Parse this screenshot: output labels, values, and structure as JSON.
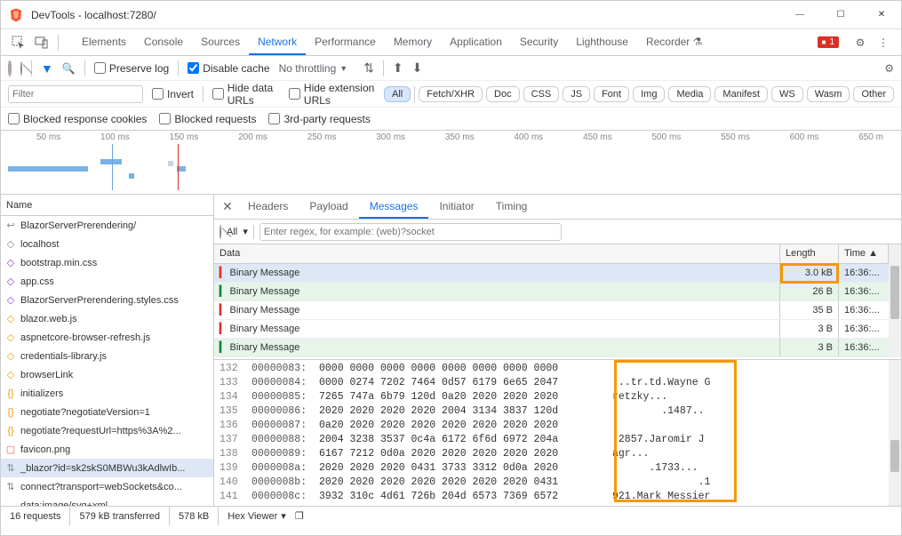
{
  "window": {
    "title": "DevTools - localhost:7280/"
  },
  "toolbar_tabs": [
    "Elements",
    "Console",
    "Sources",
    "Network",
    "Performance",
    "Memory",
    "Application",
    "Security",
    "Lighthouse",
    "Recorder ⚗"
  ],
  "toolbar_active": "Network",
  "error_count": "1",
  "network_toolbar": {
    "preserve_log": "Preserve log",
    "disable_cache": "Disable cache",
    "throttling": "No throttling"
  },
  "filter": {
    "placeholder": "Filter",
    "invert": "Invert",
    "hide_data": "Hide data URLs",
    "hide_ext": "Hide extension URLs",
    "pills": [
      "All",
      "Fetch/XHR",
      "Doc",
      "CSS",
      "JS",
      "Font",
      "Img",
      "Media",
      "Manifest",
      "WS",
      "Wasm",
      "Other"
    ],
    "active_pill": "All",
    "blocked_cookies": "Blocked response cookies",
    "blocked_req": "Blocked requests",
    "third_party": "3rd-party requests"
  },
  "timeline_ticks": [
    "50 ms",
    "100 ms",
    "150 ms",
    "200 ms",
    "250 ms",
    "300 ms",
    "350 ms",
    "400 ms",
    "450 ms",
    "500 ms",
    "550 ms",
    "600 ms",
    "650 m"
  ],
  "name_header": "Name",
  "requests": [
    {
      "icon": "↩",
      "cls": "gray",
      "label": "BlazorServerPrerendering/"
    },
    {
      "icon": "◇",
      "cls": "gray",
      "label": "localhost"
    },
    {
      "icon": "◇",
      "cls": "purple",
      "label": "bootstrap.min.css"
    },
    {
      "icon": "◇",
      "cls": "purple",
      "label": "app.css"
    },
    {
      "icon": "◇",
      "cls": "purple",
      "label": "BlazorServerPrerendering.styles.css"
    },
    {
      "icon": "◇",
      "cls": "orange",
      "label": "blazor.web.js"
    },
    {
      "icon": "◇",
      "cls": "orange",
      "label": "aspnetcore-browser-refresh.js"
    },
    {
      "icon": "◇",
      "cls": "orange",
      "label": "credentials-library.js"
    },
    {
      "icon": "◇",
      "cls": "orange",
      "label": "browserLink"
    },
    {
      "icon": "{}",
      "cls": "orange",
      "label": "initializers"
    },
    {
      "icon": "{}",
      "cls": "orange",
      "label": "negotiate?negotiateVersion=1"
    },
    {
      "icon": "{}",
      "cls": "orange",
      "label": "negotiate?requestUrl=https%3A%2..."
    },
    {
      "icon": "▢",
      "cls": "pink",
      "label": "favicon.png"
    },
    {
      "icon": "⇅",
      "cls": "gray",
      "label": "_blazor?id=sk2skS0MBWu3kAdlwIb...",
      "sel": true
    },
    {
      "icon": "⇅",
      "cls": "gray",
      "label": "connect?transport=webSockets&co..."
    },
    {
      "icon": "",
      "cls": "gray",
      "label": "data:image/svg+xml,..."
    }
  ],
  "detail_tabs": [
    "Headers",
    "Payload",
    "Messages",
    "Initiator",
    "Timing"
  ],
  "detail_active": "Messages",
  "msg_filter": {
    "all": "All",
    "placeholder": "Enter regex, for example: (web)?socket"
  },
  "msg_headers": {
    "data": "Data",
    "length": "Length",
    "time": "Time"
  },
  "messages": [
    {
      "dir": "up",
      "label": "Binary Message",
      "len": "3.0 kB",
      "time": "16:36:...",
      "sel": true
    },
    {
      "dir": "dn",
      "label": "Binary Message",
      "len": "26 B",
      "time": "16:36:...",
      "green": true
    },
    {
      "dir": "up",
      "label": "Binary Message",
      "len": "35 B",
      "time": "16:36:..."
    },
    {
      "dir": "up",
      "label": "Binary Message",
      "len": "3 B",
      "time": "16:36:..."
    },
    {
      "dir": "dn",
      "label": "Binary Message",
      "len": "3 B",
      "time": "16:36:...",
      "green": true
    }
  ],
  "hex": [
    {
      "ln": "132",
      "addr": "00000083:",
      "bytes": "0000 0000 0000 0000 0000 0000 0000 0000",
      "ascii": ""
    },
    {
      "ln": "133",
      "addr": "00000084:",
      "bytes": "0000 0274 7202 7464 0d57 6179 6e65 2047",
      "ascii": "...tr.td.Wayne G"
    },
    {
      "ln": "134",
      "addr": "00000085:",
      "bytes": "7265 747a 6b79 120d 0a20 2020 2020 2020",
      "ascii": "retzky..."
    },
    {
      "ln": "135",
      "addr": "00000086:",
      "bytes": "2020 2020 2020 2020 2004 3134 3837 120d",
      "ascii": "        .1487.."
    },
    {
      "ln": "136",
      "addr": "00000087:",
      "bytes": "0a20 2020 2020 2020 2020 2020 2020 2020",
      "ascii": "."
    },
    {
      "ln": "137",
      "addr": "00000088:",
      "bytes": "2004 3238 3537 0c4a 6172 6f6d 6972 204a",
      "ascii": ".2857.Jaromir J"
    },
    {
      "ln": "138",
      "addr": "00000089:",
      "bytes": "6167 7212 0d0a 2020 2020 2020 2020 2020",
      "ascii": "agr..."
    },
    {
      "ln": "139",
      "addr": "0000008a:",
      "bytes": "2020 2020 2020 0431 3733 3312 0d0a 2020",
      "ascii": "      .1733..."
    },
    {
      "ln": "140",
      "addr": "0000008b:",
      "bytes": "2020 2020 2020 2020 2020 2020 2020 0431",
      "ascii": "              .1"
    },
    {
      "ln": "141",
      "addr": "0000008c:",
      "bytes": "3932 310c 4d61 726b 204d 6573 7369 6572",
      "ascii": "921.Mark Messier"
    }
  ],
  "status": {
    "requests": "16 requests",
    "transferred": "579 kB transferred",
    "resources": "578 kB",
    "hex_viewer": "Hex Viewer"
  }
}
